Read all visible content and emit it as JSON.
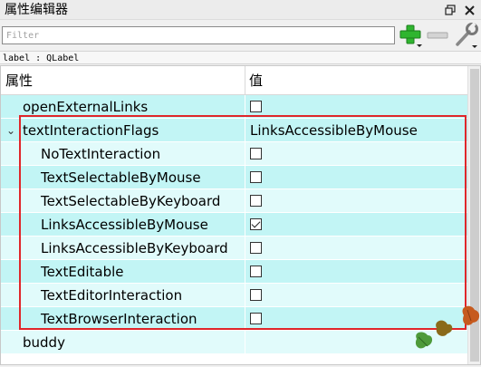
{
  "window": {
    "title": "属性编辑器",
    "float_icon": "float-restore-icon",
    "close_icon": "close-icon"
  },
  "filter": {
    "placeholder": "Filter",
    "value": ""
  },
  "toolbar": {
    "add_icon": "plus-icon",
    "remove_icon": "minus-icon",
    "config_icon": "wrench-icon"
  },
  "object_label": "label : QLabel",
  "tree": {
    "header": {
      "property": "属性",
      "value": "值"
    },
    "rows": [
      {
        "name": "openExternalLinks",
        "indent": 0,
        "type": "checkbox",
        "checked": false,
        "shade": "dark"
      },
      {
        "name": "textInteractionFlags",
        "indent": 0,
        "type": "text",
        "value": "LinksAccessibleByMouse",
        "expanded": true,
        "shade": "dark"
      },
      {
        "name": "NoTextInteraction",
        "indent": 1,
        "type": "checkbox",
        "checked": false,
        "shade": "light"
      },
      {
        "name": "TextSelectableByMouse",
        "indent": 1,
        "type": "checkbox",
        "checked": false,
        "shade": "dark"
      },
      {
        "name": "TextSelectableByKeyboard",
        "indent": 1,
        "type": "checkbox",
        "checked": false,
        "shade": "light"
      },
      {
        "name": "LinksAccessibleByMouse",
        "indent": 1,
        "type": "checkbox",
        "checked": true,
        "shade": "dark"
      },
      {
        "name": "LinksAccessibleByKeyboard",
        "indent": 1,
        "type": "checkbox",
        "checked": false,
        "shade": "light"
      },
      {
        "name": "TextEditable",
        "indent": 1,
        "type": "checkbox",
        "checked": false,
        "shade": "dark"
      },
      {
        "name": "TextEditorInteraction",
        "indent": 1,
        "type": "checkbox",
        "checked": false,
        "shade": "light"
      },
      {
        "name": "TextBrowserInteraction",
        "indent": 1,
        "type": "checkbox",
        "checked": false,
        "shade": "dark"
      },
      {
        "name": "buddy",
        "indent": 0,
        "type": "text",
        "value": "",
        "shade": "light"
      }
    ]
  },
  "colors": {
    "row_dark": "#c2f5f5",
    "row_light": "#e1fbfb",
    "highlight": "#e0262a",
    "add_green": "#2fb52f"
  }
}
